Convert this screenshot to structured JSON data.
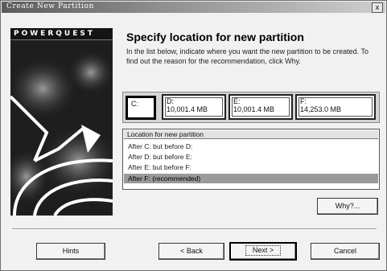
{
  "window": {
    "title": "Create New Partition",
    "close_label": "x"
  },
  "brand": "POWERQUEST",
  "heading": "Specify location for new partition",
  "instructions": "In the list below, indicate where you want the new partition to be created.  To find out the reason for the recommendation, click Why.",
  "partitions": [
    {
      "letter": "C:",
      "size": ""
    },
    {
      "letter": "D:",
      "size": "10,001.4 MB"
    },
    {
      "letter": "E:",
      "size": "10,001.4 MB"
    },
    {
      "letter": "F:",
      "size": "14,253.0 MB"
    }
  ],
  "location_list": {
    "header": "Location for new partition",
    "items": [
      "After C:  but before D:",
      "After D:  but before E:",
      "After E:  but before F:",
      "After F:    (recommended)"
    ],
    "selected_index": 3
  },
  "buttons": {
    "why": "Why?...",
    "hints": "Hints",
    "back": "< Back",
    "next": "Next >",
    "cancel": "Cancel"
  }
}
